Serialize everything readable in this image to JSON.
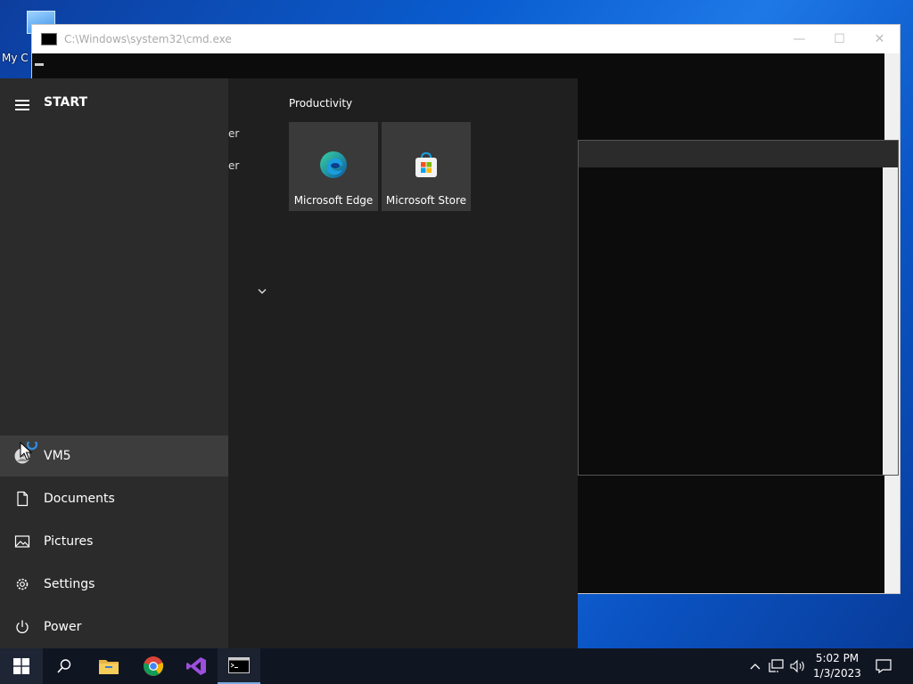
{
  "desktop": {
    "icon_label": "My C"
  },
  "cmd_window": {
    "title": "C:\\Windows\\system32\\cmd.exe",
    "min": "—",
    "max": "☐",
    "close": "✕"
  },
  "start_menu": {
    "title": "START",
    "user": "VM5",
    "items": [
      {
        "label": "Documents",
        "icon": "document-icon"
      },
      {
        "label": "Pictures",
        "icon": "pictures-icon"
      },
      {
        "label": "Settings",
        "icon": "gear-icon"
      },
      {
        "label": "Power",
        "icon": "power-icon"
      }
    ],
    "list_fragments": [
      "er",
      "er"
    ],
    "group_label": "Productivity",
    "tiles": [
      {
        "label": "Microsoft Edge",
        "icon": "edge-icon"
      },
      {
        "label": "Microsoft Store",
        "icon": "store-icon"
      }
    ]
  },
  "taskbar": {
    "apps": [
      "search-icon",
      "file-explorer-icon",
      "chrome-icon",
      "visual-studio-icon",
      "cmd-icon"
    ],
    "clock": {
      "time": "5:02 PM",
      "date": "1/3/2023"
    }
  },
  "colors": {
    "accent": "#0078d4",
    "start_bg": "#2b2b2b",
    "tile_bg": "#3a3a3a",
    "taskbar_bg": "#101522"
  }
}
